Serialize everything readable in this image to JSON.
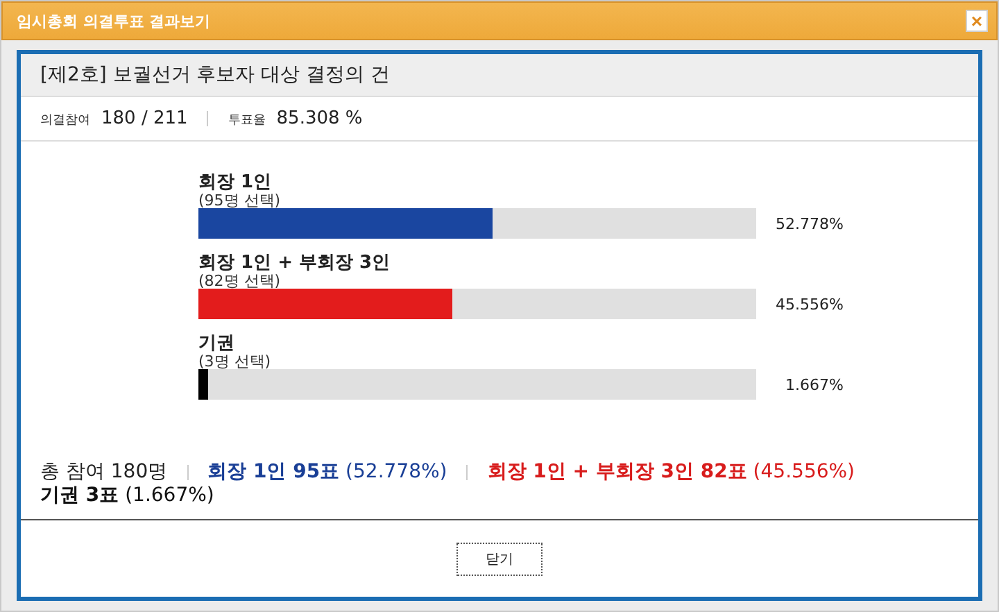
{
  "window": {
    "title": "임시총회 의결투표 결과보기",
    "close": "×"
  },
  "agenda": {
    "title": "[제2호] 보궐선거 후보자 대상 결정의 건"
  },
  "stats": [
    {
      "label": "의결참여",
      "value": "180 / 211"
    },
    {
      "label": "투표율",
      "value": "85.308 %"
    }
  ],
  "options": [
    {
      "label": "회장 1인",
      "count": "(95명 선택)",
      "level": 0.52778,
      "percent": "52.778%",
      "color": "#1a46a0"
    },
    {
      "label": "회장 1인 + 부회장 3인",
      "count": "(82명 선택)",
      "level": 0.45556,
      "percent": "45.556%",
      "color": "#e31c1c"
    },
    {
      "label": "기권",
      "count": "(3명 선택)",
      "level": 0.01667,
      "percent": "1.667%",
      "color": "#000000"
    }
  ],
  "summary": [
    {
      "text": "총 참여 180명",
      "color": "#222222",
      "separator": true
    },
    {
      "text": "**회장 1인 95표** (52.778%)",
      "color": "#1a3f96",
      "separator": true
    },
    {
      "text": "**회장 1인 + 부회장 3인 82표** (45.556%)",
      "color": "#d81c1c",
      "separator": false
    },
    {
      "text": "**기권 3표** (1.667%)",
      "color": "#111111",
      "separator": false
    }
  ],
  "buttons": [
    "닫기"
  ]
}
